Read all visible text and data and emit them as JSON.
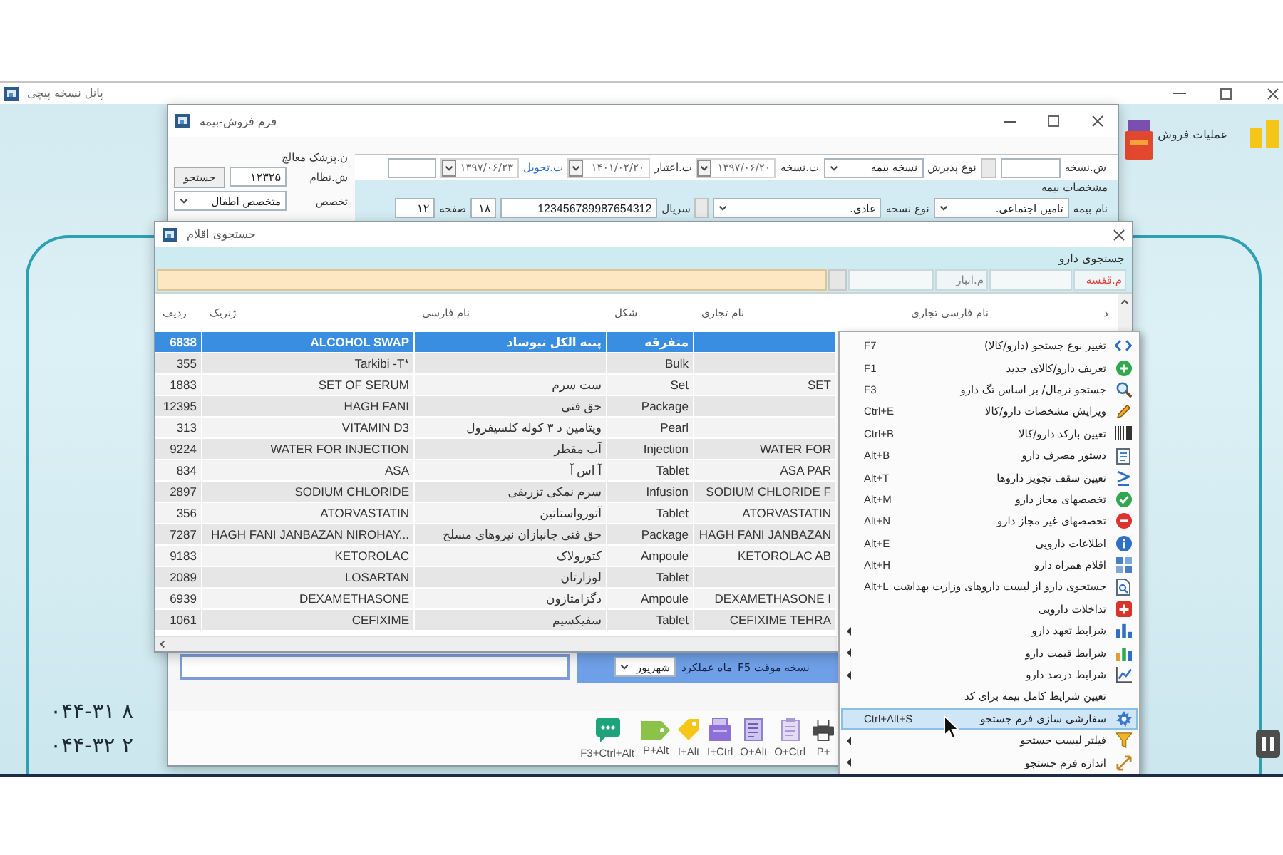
{
  "app_window": {
    "title": "پانل نسخه پیچی",
    "section_title": "عملیات فروش",
    "phone_numbers": [
      "۰۴۴-۳۱ ۸",
      "۰۴۴-۳۲ ۲"
    ]
  },
  "sales_form": {
    "title": "فرم فروش-بیمه",
    "prescription_fields": [
      {
        "kind": "label",
        "text": "ش.نسخه"
      },
      {
        "kind": "input"
      },
      {
        "kind": "button"
      },
      {
        "kind": "label",
        "text": "نوع پذیرش"
      },
      {
        "kind": "select",
        "value": "نسخه بیمه"
      },
      {
        "kind": "label",
        "text": "ت.نسخه"
      },
      {
        "kind": "date",
        "value": "۱۳۹۷/۰۶/۲۰"
      },
      {
        "kind": "label",
        "text": "ت.اعتبار"
      },
      {
        "kind": "date",
        "value": "۱۴۰۱/۰۲/۲۰"
      },
      {
        "kind": "link",
        "text": "ت.تحویل"
      },
      {
        "kind": "date",
        "value": "۱۳۹۷/۰۶/۲۳"
      },
      {
        "kind": "input"
      }
    ],
    "insurance": {
      "title": "مشخصات بیمه",
      "fields": [
        {
          "kind": "label",
          "text": "نام بیمه"
        },
        {
          "kind": "select",
          "value": "تامین اجتماعی."
        },
        {
          "kind": "label",
          "text": "نوع نسخه"
        },
        {
          "kind": "select",
          "value": "عادی."
        },
        {
          "kind": "button"
        },
        {
          "kind": "label",
          "text": "سریال"
        },
        {
          "kind": "input",
          "value": "123456789987654312"
        },
        {
          "kind": "input",
          "value": "۱۸"
        },
        {
          "kind": "label",
          "text": "صفحه"
        },
        {
          "kind": "input",
          "value": "۱۲"
        }
      ]
    },
    "doctor": {
      "title": "ن.پزشک معالج",
      "license_label": "ش.نظام",
      "license_number": "۱۲۳۲۵",
      "search_button": "جستجو",
      "specialty_label": "تخصص",
      "specialty": "متخصص اطفال"
    },
    "temporary_prescription": {
      "label": "نسخه موقت F5",
      "month_label": "ماه عملکرد",
      "month": "شهریور"
    },
    "toolbar": [
      "P+",
      "O+Ctrl",
      "O+Alt",
      "I+Ctrl",
      "I+Alt",
      "P+Alt",
      "F3+Ctrl+Alt"
    ]
  },
  "search_window": {
    "title": "جستجوی اقلام",
    "subtitle": "جستجوی دارو",
    "filters": [
      {
        "label": "م.قفسه",
        "color": "#d9443c"
      },
      {
        "label": "م.انبار",
        "color": "#7d7d7d"
      }
    ],
    "table": {
      "columns": [
        "د",
        "نام فارسی تجاری",
        "نام تجاری",
        "شکل",
        "نام فارسی",
        "ژنریک",
        "ردیف"
      ],
      "rows": [
        {
          "form": "متفرقه",
          "persian_name": "پنبه الکل نیوساد",
          "generic": "ALCOHOL SWAP",
          "number": "6838",
          "selected": true
        },
        {
          "form": "Bulk",
          "generic": "Tarkibi -T*",
          "number": "355",
          "selected": false
        },
        {
          "trade_name": "SET",
          "form": "Set",
          "persian_name": "ست سرم",
          "generic": "SET OF SERUM",
          "number": "1883",
          "selected": false
        },
        {
          "form": "Package",
          "persian_name": "حق فنی",
          "generic": "HAGH FANI",
          "number": "12395",
          "selected": false
        },
        {
          "form": "Pearl",
          "persian_name": "ویتامین د ۳ کوله کلسیفرول",
          "generic": "VITAMIN D3",
          "number": "313",
          "selected": false
        },
        {
          "trade_name": "WATER FOR",
          "form": "Injection",
          "persian_name": "آب مقطر",
          "generic": "WATER FOR INJECTION",
          "number": "9224",
          "selected": false
        },
        {
          "trade_name": "ASA PAR",
          "form": "Tablet",
          "persian_name": "آ اس آ",
          "generic": "ASA",
          "number": "834",
          "selected": false
        },
        {
          "trade_name": "SODIUM CHLORIDE F",
          "form": "Infusion",
          "persian_name": "سرم نمکی تزریقی",
          "generic": "SODIUM CHLORIDE",
          "number": "2897",
          "selected": false
        },
        {
          "trade_name": "ATORVASTATIN",
          "form": "Tablet",
          "persian_name": "آتورواستاتین",
          "generic": "ATORVASTATIN",
          "number": "356",
          "selected": false
        },
        {
          "trade_name": "HAGH FANI JANBAZAN",
          "form": "Package",
          "persian_name": "حق فنی جانبازان نیروهای مسلح",
          "generic": "HAGH FANI JANBAZAN NIROHAY...",
          "number": "7287",
          "selected": false
        },
        {
          "trade_name": "KETOROLAC AB",
          "form": "Ampoule",
          "persian_name": "کتورولاک",
          "generic": "KETOROLAC",
          "number": "9183",
          "selected": false
        },
        {
          "form": "Tablet",
          "persian_name": "لوزارتان",
          "generic": "LOSARTAN",
          "number": "2089",
          "selected": false
        },
        {
          "trade_name": "DEXAMETHASONE I",
          "form": "Ampoule",
          "persian_name": "دگزامتازون",
          "generic": "DEXAMETHASONE",
          "number": "6939",
          "selected": false
        },
        {
          "trade_name": "CEFIXIME TEHRA",
          "form": "Tablet",
          "persian_name": "سفیکسیم",
          "generic": "CEFIXIME",
          "number": "1061",
          "selected": false
        }
      ]
    }
  },
  "context_menu": {
    "items": [
      {
        "label": "تغییر نوع جستجو (دارو/کالا)",
        "shortcut": "F7",
        "submenu": false,
        "selected": false
      },
      {
        "label": "تعریف دارو/کالای جدید",
        "shortcut": "F1",
        "submenu": false,
        "selected": false
      },
      {
        "label": "جستجو نرمال/ بر اساس تگ دارو",
        "shortcut": "F3",
        "submenu": false,
        "selected": false
      },
      {
        "label": "ویرایش مشخصات دارو/کالا",
        "shortcut": "Ctrl+E",
        "submenu": false,
        "selected": false
      },
      {
        "label": "تعیین بارکد دارو/کالا",
        "shortcut": "Ctrl+B",
        "submenu": false,
        "selected": false
      },
      {
        "label": "دستور مصرف دارو",
        "shortcut": "Alt+B",
        "submenu": false,
        "selected": false
      },
      {
        "label": "تعیین سقف تجویز داروها",
        "shortcut": "Alt+T",
        "submenu": false,
        "selected": false
      },
      {
        "label": "تخصصهای مجاز دارو",
        "shortcut": "Alt+M",
        "submenu": false,
        "selected": false
      },
      {
        "label": "تخصصهای غیر مجاز دارو",
        "shortcut": "Alt+N",
        "submenu": false,
        "selected": false
      },
      {
        "label": "اطلاعات دارویی",
        "shortcut": "Alt+E",
        "submenu": false,
        "selected": false
      },
      {
        "label": "اقلام همراه دارو",
        "shortcut": "Alt+H",
        "submenu": false,
        "selected": false
      },
      {
        "label": "جستجوی دارو از لیست داروهای وزارت بهداشت",
        "shortcut": "Alt+L",
        "submenu": false,
        "selected": false
      },
      {
        "label": "تداخلات دارویی",
        "submenu": false,
        "selected": false
      },
      {
        "label": "شرایط تعهد دارو",
        "submenu": true,
        "selected": false
      },
      {
        "label": "شرایط قیمت دارو",
        "submenu": true,
        "selected": false
      },
      {
        "label": "شرایط درصد دارو",
        "submenu": true,
        "selected": false
      },
      {
        "label": "تعیین شرایط کامل بیمه برای کد",
        "submenu": false,
        "selected": false
      },
      {
        "label": "سفارشی سازی فرم جستجو",
        "shortcut": "Ctrl+Alt+S",
        "submenu": false,
        "selected": true
      },
      {
        "label": "فیلتر لیست جستجو",
        "submenu": true,
        "selected": false
      },
      {
        "label": "اندازه فرم جستجو",
        "submenu": true,
        "selected": false
      }
    ]
  }
}
